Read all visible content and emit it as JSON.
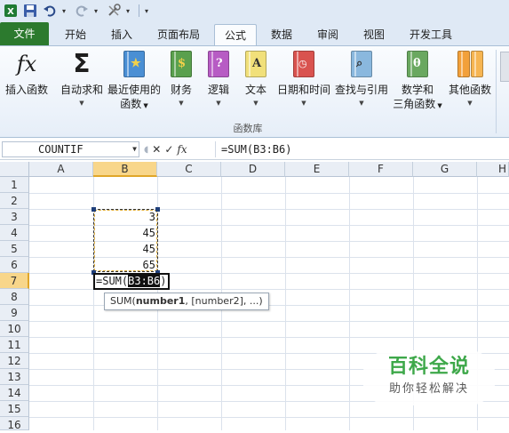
{
  "quick_access": {
    "items": [
      "excel-logo",
      "save",
      "undo",
      "redo",
      "customize-tool",
      "qat-menu"
    ]
  },
  "ribbon_tabs": [
    "文件",
    "开始",
    "插入",
    "页面布局",
    "公式",
    "数据",
    "审阅",
    "视图",
    "开发工具"
  ],
  "active_tab": "公式",
  "ribbon": {
    "buttons": [
      {
        "label": "插入函数",
        "label2": ""
      },
      {
        "label": "自动求和",
        "label2": ""
      },
      {
        "label": "最近使用的",
        "label2": "函数"
      },
      {
        "label": "财务",
        "label2": ""
      },
      {
        "label": "逻辑",
        "label2": ""
      },
      {
        "label": "文本",
        "label2": ""
      },
      {
        "label": "日期和时间",
        "label2": ""
      },
      {
        "label": "查找与引用",
        "label2": ""
      },
      {
        "label": "数学和",
        "label2": "三角函数"
      },
      {
        "label": "其他函数",
        "label2": ""
      }
    ],
    "group_label": "函数库",
    "icon_glyphs": {
      "insert_function": "fx",
      "autosum": "Σ"
    }
  },
  "formula_bar": {
    "name_box": "COUNTIF",
    "cancel_symbol": "✕",
    "enter_symbol": "✓",
    "fx_symbol": "fx",
    "formula": "=SUM(B3:B6)"
  },
  "sheet": {
    "columns": [
      "A",
      "B",
      "C",
      "D",
      "E",
      "F",
      "G",
      "H"
    ],
    "rows": [
      "1",
      "2",
      "3",
      "4",
      "5",
      "6",
      "7",
      "8",
      "9",
      "10",
      "11",
      "12",
      "13",
      "14",
      "15",
      "16"
    ],
    "selected_column": "B",
    "selected_row": "7",
    "cells": {
      "B3": "3",
      "B4": "45",
      "B5": "45",
      "B6": "65"
    },
    "edit_cell": {
      "address": "B7",
      "text_before": "=SUM(",
      "text_highlight": "B3:B6",
      "text_after": ")"
    },
    "tooltip": {
      "func": "SUM(",
      "bold_arg": "number1",
      "rest": ", [number2], ...)"
    }
  },
  "watermark": {
    "title": "百科全说",
    "subtitle": "助你轻松解决"
  },
  "colors": {
    "file_tab": "#2c7a2e",
    "selection_header": "#f8d68a",
    "watermark_green": "#3ea84a"
  }
}
